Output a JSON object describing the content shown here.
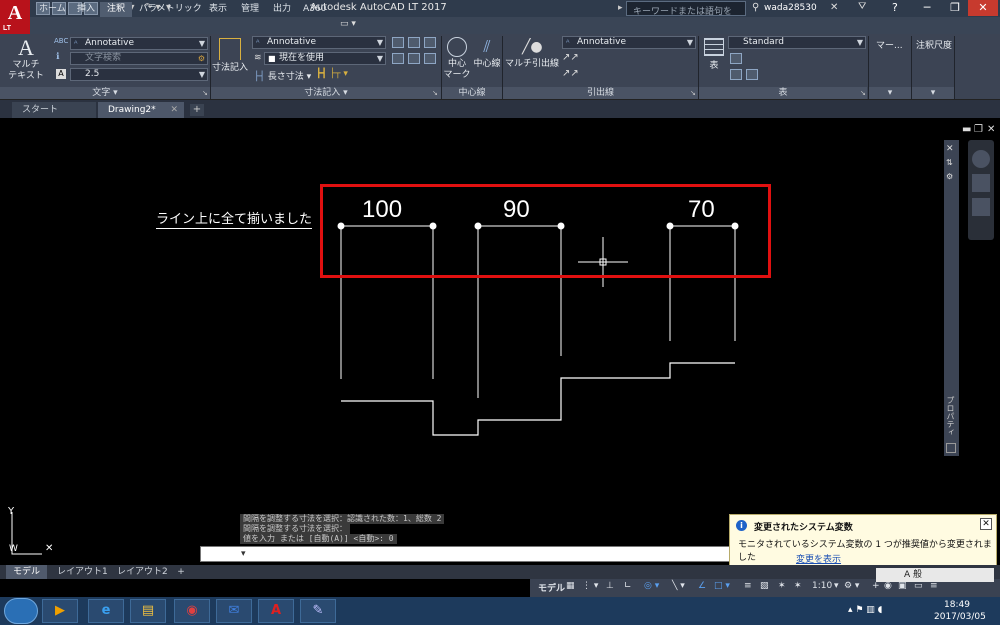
{
  "app": {
    "title": "Autodesk AutoCAD LT 2017",
    "logo_letter": "A",
    "logo_sub": "LT",
    "search_placeholder": "キーワードまたは語句を入力",
    "user": "wada28530"
  },
  "ribbon_tabs": [
    "ホーム",
    "挿入",
    "注釈",
    "パラメトリック",
    "表示",
    "管理",
    "出力",
    "A360"
  ],
  "ribbon_active_tab": "注釈",
  "text_panel": {
    "big_button": "マルチ\nテキスト",
    "style": "Annotative",
    "find_placeholder": "文字検索",
    "height": "2.5",
    "label": "文字 ▾"
  },
  "dim_panel": {
    "big_button": "寸法記入",
    "style": "Annotative",
    "layer": "現在を使用",
    "linear": "長さ寸法",
    "label": "寸法記入 ▾"
  },
  "centerline_panel": {
    "center_mark": "中心\nマーク",
    "center_line": "中心線",
    "label": "中心線"
  },
  "leader_panel": {
    "big_button": "マルチ引出線",
    "style": "Annotative",
    "label": "引出線"
  },
  "table_panel": {
    "big_button": "表",
    "style": "Standard",
    "label": "表"
  },
  "markup_panel": {
    "label": "マー..."
  },
  "scale_panel": {
    "label": "注釈尺度"
  },
  "doc_tabs": [
    "スタート",
    "Drawing2*"
  ],
  "drawing": {
    "note": "ライン上に全て揃いました",
    "dim1": "100",
    "dim2": "90",
    "dim3": "70",
    "highlight_color": "#e01010"
  },
  "palette_label": "プロパティ",
  "command_history": [
    "間隔を調整する寸法を選択：認識された数：1、総数 2",
    "間隔を調整する寸法を選択：",
    "値を入力 または [自動(A)] <自動>: 0"
  ],
  "notification": {
    "title": "変更されたシステム変数",
    "body": "モニタされているシステム変数の 1 つが推奨値から変更されました",
    "link": "変更を表示"
  },
  "layout_tabs": [
    "モデル",
    "レイアウト1",
    "レイアウト2"
  ],
  "status": {
    "model": "モデル",
    "scale": "1:10"
  },
  "taskbar": {
    "time": "18:49",
    "date": "2017/03/05",
    "ime": "A 般"
  }
}
